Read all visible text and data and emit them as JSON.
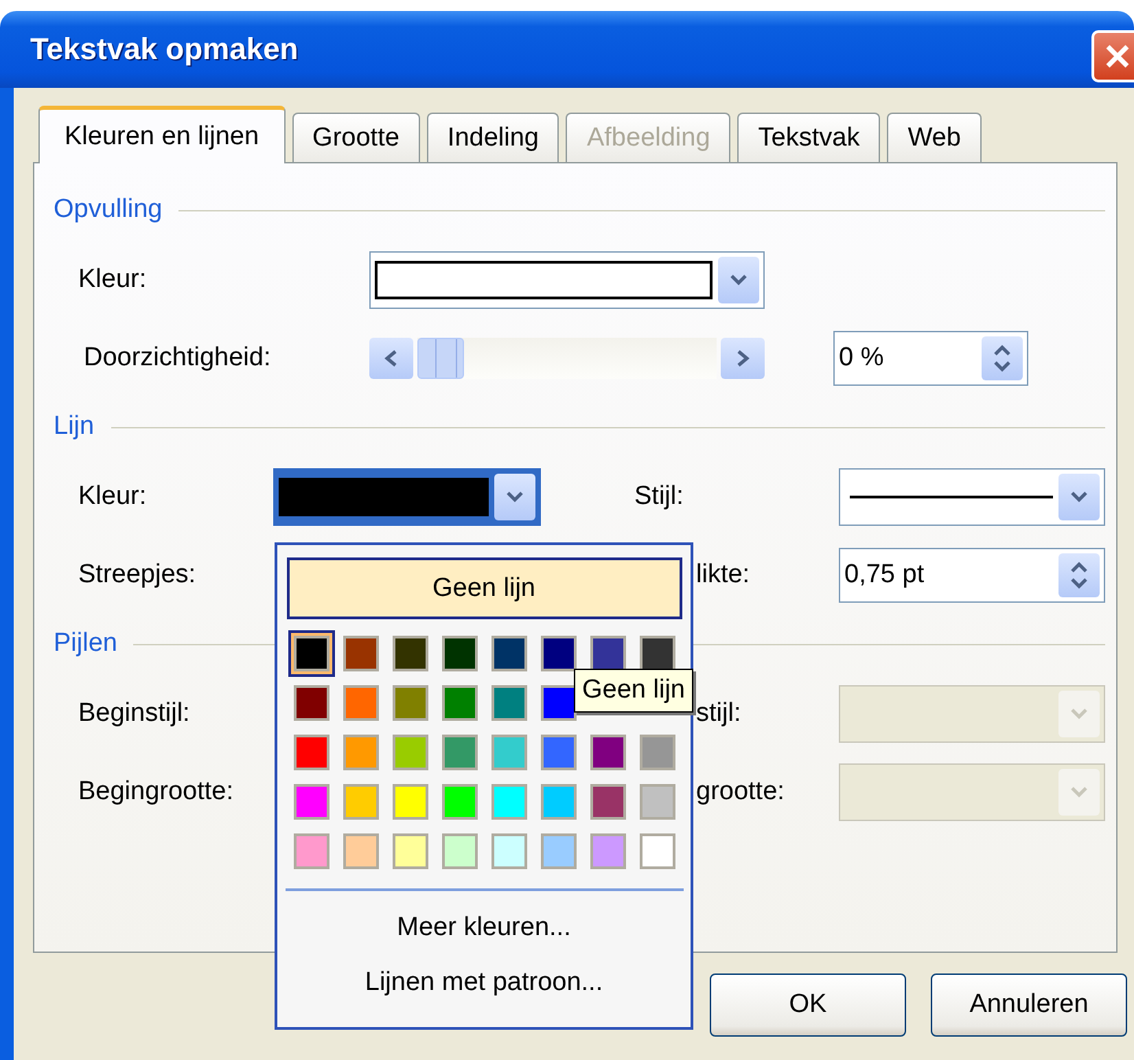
{
  "window": {
    "title": "Tekstvak opmaken"
  },
  "tabs": [
    {
      "label": "Kleuren en lijnen",
      "selected": true,
      "disabled": false
    },
    {
      "label": "Grootte",
      "selected": false,
      "disabled": false
    },
    {
      "label": "Indeling",
      "selected": false,
      "disabled": false
    },
    {
      "label": "Afbeelding",
      "selected": false,
      "disabled": true
    },
    {
      "label": "Tekstvak",
      "selected": false,
      "disabled": false
    },
    {
      "label": "Web",
      "selected": false,
      "disabled": false
    }
  ],
  "fill": {
    "heading": "Opvulling",
    "color_label": "Kleur:",
    "color": "#ffffff",
    "transparency_label": "Doorzichtigheid:",
    "transparency": {
      "level": 0
    },
    "transparency_value": "0 %"
  },
  "line": {
    "heading": "Lijn",
    "color_label": "Kleur:",
    "color": "#000000",
    "style_label": "Stijl:",
    "dashes_label": "Streepjes:",
    "weight_label": "likte:",
    "weight_value": "0,75 pt"
  },
  "arrows": {
    "heading": "Pijlen",
    "begin_style_label": "Beginstijl:",
    "end_style_label": "stijl:",
    "end_style_disabled": true,
    "begin_size_label": "Begingrootte:",
    "end_size_label": "grootte:",
    "end_size_disabled": true
  },
  "color_popup": {
    "no_line_button": "Geen lijn",
    "swatches": [
      {
        "color": "#000000",
        "selected": true
      },
      {
        "color": "#993300",
        "selected": false
      },
      {
        "color": "#333300",
        "selected": false
      },
      {
        "color": "#003300",
        "selected": false
      },
      {
        "color": "#003366",
        "selected": false
      },
      {
        "color": "#000080",
        "selected": false
      },
      {
        "color": "#333399",
        "selected": false
      },
      {
        "color": "#333333",
        "selected": false
      },
      {
        "color": "#800000",
        "selected": false
      },
      {
        "color": "#ff6600",
        "selected": false
      },
      {
        "color": "#808000",
        "selected": false
      },
      {
        "color": "#008000",
        "selected": false
      },
      {
        "color": "#008080",
        "selected": false
      },
      {
        "color": "#0000ff",
        "selected": false
      },
      {
        "kind": "covered"
      },
      {
        "kind": "covered"
      },
      {
        "color": "#ff0000",
        "selected": false
      },
      {
        "color": "#ff9900",
        "selected": false
      },
      {
        "color": "#99cc00",
        "selected": false
      },
      {
        "color": "#339966",
        "selected": false
      },
      {
        "color": "#33cccc",
        "selected": false
      },
      {
        "color": "#3366ff",
        "selected": false
      },
      {
        "color": "#800080",
        "selected": false
      },
      {
        "color": "#969696",
        "selected": false
      },
      {
        "color": "#ff00ff",
        "selected": false
      },
      {
        "color": "#ffcc00",
        "selected": false
      },
      {
        "color": "#ffff00",
        "selected": false
      },
      {
        "color": "#00ff00",
        "selected": false
      },
      {
        "color": "#00ffff",
        "selected": false
      },
      {
        "color": "#00ccff",
        "selected": false
      },
      {
        "color": "#993366",
        "selected": false
      },
      {
        "color": "#c0c0c0",
        "selected": false
      },
      {
        "color": "#ff99cc",
        "selected": false
      },
      {
        "color": "#ffcc99",
        "selected": false
      },
      {
        "color": "#ffff99",
        "selected": false
      },
      {
        "color": "#ccffcc",
        "selected": false
      },
      {
        "color": "#ccffff",
        "selected": false
      },
      {
        "color": "#99ccff",
        "selected": false
      },
      {
        "color": "#cc99ff",
        "selected": false
      },
      {
        "color": "#ffffff",
        "selected": false
      }
    ],
    "more_colors": "Meer kleuren...",
    "patterned_lines": "Lijnen met patroon..."
  },
  "tooltip": "Geen lijn",
  "buttons": [
    "OK",
    "Annuleren"
  ]
}
